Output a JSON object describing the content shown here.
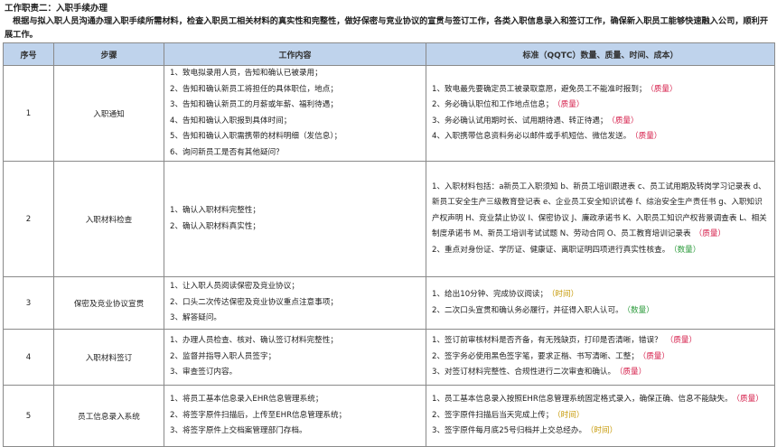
{
  "doc": {
    "title": "工作职责二：入职手续办理",
    "intro": "根据与拟入职人员沟通办理入职手续所需材料，检查入职员工相关材料的真实性和完整性，做好保密与竞业协议的宣贯与签订工作，各类入职信息录入和签订工作，确保新入职员工能够快速融入公司，顺利开展工作。"
  },
  "table": {
    "headers": {
      "no": "序号",
      "step": "步骤",
      "content": "工作内容",
      "standard": "标准（QQTC）数量、质量、时间、成本）"
    },
    "rows": [
      {
        "no": "1",
        "step": "入职通知",
        "content": [
          "1、致电拟录用人员，告知和确认已被录用；",
          "2、告知和确认新员工将担任的具体职位，地点；",
          "3、告知和确认新员工的月薪或年薪、福利待遇；",
          "4、告知和确认入职报到具体时间；",
          "5、告知和确认入职需携带的材料明细（发信息）；",
          "6、询问新员工是否有其他疑问？"
        ],
        "standard": [
          {
            "text": "1、致电最先要确定员工被录取意愿，避免员工不能准时报到；",
            "tag": "（质量）",
            "cls": "q"
          },
          {
            "text": "2、务必确认职位和工作地点信息；",
            "tag": "（质量）",
            "cls": "q"
          },
          {
            "text": "3、务必确认试用期时长、试用期待遇、转正待遇；",
            "tag": "（质量）",
            "cls": "q"
          },
          {
            "text": "4、入职携带信息资料务必以邮件或手机短信、微信发送。",
            "tag": "（质量）",
            "cls": "q"
          }
        ]
      },
      {
        "no": "2",
        "step": "入职材料检查",
        "content": [
          "1、确认入职材料完整性；",
          "2、确认入职材料真实性；"
        ],
        "standard": [
          {
            "text": "1、入职材料包括：a新员工入职须知 b、新员工培训跟进表 c、员工试用期及转岗学习记录表 d、新员工安全生产三级教育登记表 e、企业员工安全知识试卷 f、综治安全生产责任书 g、入职知识产权声明 H、竞业禁止协议 I、保密协议 J、廉政承诺书 K、入职员工知识产权背景调查表 L、相关制度承诺书 M、新员工培训考试试题 N、劳动合同 O、员工教育培训记录表",
            "tag": "（质量）",
            "cls": "q"
          },
          {
            "text": "2、重点对身份证、学历证、健康证、离职证明四项进行真实性核查。",
            "tag": "（数量）",
            "cls": "n"
          }
        ]
      },
      {
        "no": "3",
        "step": "保密及竞业协议宣贯",
        "content": [
          "1、让入职人员阅读保密及竞业协议；",
          "2、口头二次传达保密及竞业协议重点注意事项；",
          "3、解答疑问。"
        ],
        "standard": [
          {
            "text": "1、给出10分钟、完成协议阅读；",
            "tag": "（时间）",
            "cls": "t"
          },
          {
            "text": "2、二次口头宣贯和确认务必履行，并征得入职人认可。",
            "tag": "（数量）",
            "cls": "n"
          }
        ]
      },
      {
        "no": "4",
        "step": "入职材料签订",
        "content": [
          "1、办理人员检查、核对、确认签订材料完整性；",
          "2、监督并指导入职人员签字；",
          "3、审查签订内容。"
        ],
        "standard": [
          {
            "text": "1、签订前审核材料是否齐备，有无残缺页，打印是否清晰，错误？",
            "tag": "（质量）",
            "cls": "q"
          },
          {
            "text": "2、签字务必使用黑色签字笔，要求正楷、书写清晰、工整；",
            "tag": "（质量）",
            "cls": "q"
          },
          {
            "text": "3、对签订材料完整性、合规性进行二次审查和确认。",
            "tag": "（质量）",
            "cls": "q"
          }
        ]
      },
      {
        "no": "5",
        "step": "员工信息录入系统",
        "content": [
          "1、将员工基本信息录入EHR信息管理系统；",
          "2、将签字原件扫描后，上传至EHR信息管理系统；",
          "3、将签字原件上交档案管理部门存档。"
        ],
        "standard": [
          {
            "text": "1、员工基本信息录入按照EHR信息管理系统固定格式录入，确保正确、信息不能缺失。",
            "tag": "（质量）",
            "cls": "q"
          },
          {
            "text": "2、签字原件扫描后当天完成上传；",
            "tag": "（时间）",
            "cls": "t"
          },
          {
            "text": "3、签字原件每月底25号归档并上交总经办。",
            "tag": "（时间）",
            "cls": "t"
          }
        ]
      }
    ]
  }
}
